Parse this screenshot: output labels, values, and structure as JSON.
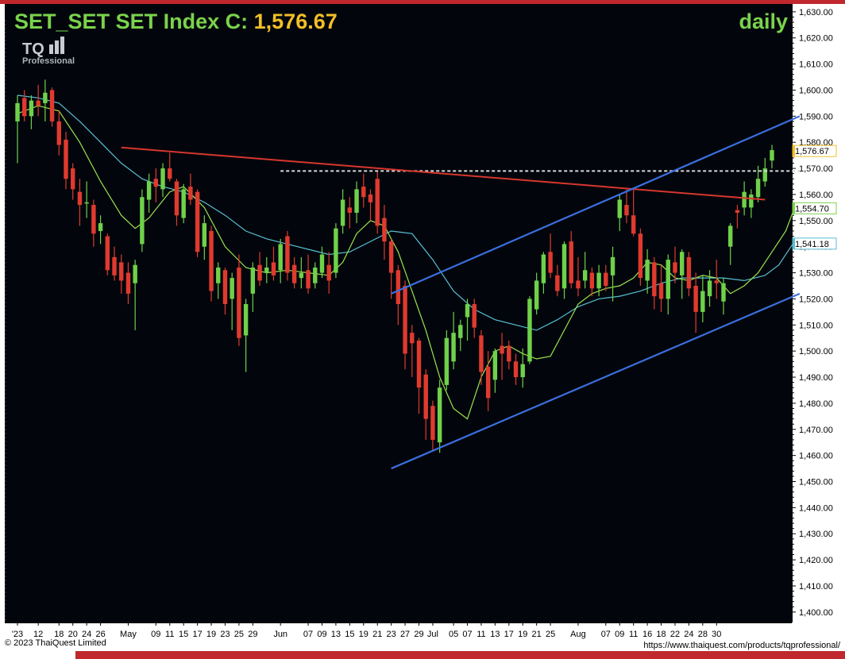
{
  "header": {
    "symbol": "SET",
    "name": "SET Index",
    "close_label": "C:",
    "close_value": "1,576.67",
    "period": "daily",
    "logo_text": "TQ",
    "logo_sub": "Professional"
  },
  "footer": {
    "copyright": "© 2023 ThaiQuest Limited",
    "url": "https://www.thaiquest.com/products/tqprofessional/"
  },
  "colors": {
    "background": "#02060c",
    "up": "#6fd14a",
    "down": "#e03a2f",
    "title": "#7ad34b",
    "close_value": "#f2bf26",
    "ma_fast": "#9be34e",
    "ma_slow": "#57bfd4",
    "trend_channel": "#3b6fe0",
    "resistance_line": "#d8362e",
    "dashed_level": "#d8d8d8"
  },
  "chart_data": {
    "type": "candlestick",
    "title": "SET_SET Index C: 1,576.67",
    "period": "daily",
    "ylim": [
      1396,
      1633
    ],
    "yticks": [
      1400,
      1410,
      1420,
      1430,
      1440,
      1450,
      1460,
      1470,
      1480,
      1490,
      1500,
      1510,
      1520,
      1530,
      1540,
      1550,
      1560,
      1570,
      1580,
      1590,
      1600,
      1610,
      1620,
      1630
    ],
    "ytick_labels": [
      "1,400.00",
      "1,410.00",
      "1,420.00",
      "1,430.00",
      "1,440.00",
      "1,450.00",
      "1,460.00",
      "1,470.00",
      "1,480.00",
      "1,490.00",
      "1,500.00",
      "1,510.00",
      "1,520.00",
      "1,530.00",
      "1,540.00",
      "1,550.00",
      "1,560.00",
      "1,570.00",
      "1,580.00",
      "1,590.00",
      "1,600.00",
      "1,610.00",
      "1,620.00",
      "1,630.00"
    ],
    "xtick_labels": [
      "'23",
      "12",
      "18",
      "20",
      "24",
      "26",
      "May",
      "09",
      "11",
      "15",
      "17",
      "19",
      "23",
      "25",
      "29",
      "Jun",
      "07",
      "09",
      "13",
      "15",
      "19",
      "21",
      "23",
      "27",
      "29",
      "Jul",
      "05",
      "07",
      "11",
      "13",
      "17",
      "19",
      "21",
      "25",
      "Aug",
      "07",
      "09",
      "11",
      "16",
      "18",
      "22",
      "24",
      "28",
      "30"
    ],
    "xtick_bars": [
      0,
      3,
      6,
      8,
      10,
      12,
      16,
      20,
      22,
      24,
      26,
      28,
      30,
      32,
      34,
      38,
      42,
      44,
      46,
      48,
      50,
      52,
      54,
      56,
      58,
      60,
      63,
      65,
      67,
      69,
      71,
      73,
      75,
      77,
      81,
      85,
      87,
      89,
      91,
      93,
      95,
      97,
      99,
      101
    ],
    "price_labels": [
      {
        "value": 1576.67,
        "label": "1,576.67",
        "color": "#f2bf26"
      },
      {
        "value": 1554.7,
        "label": "1,554.70",
        "color": "#7ad34b"
      },
      {
        "value": 1541.18,
        "label": "1,541.18",
        "color": "#57bfd4"
      }
    ],
    "candles": [
      [
        1588,
        1598,
        1572,
        1595
      ],
      [
        1597,
        1600,
        1588,
        1590
      ],
      [
        1590,
        1598,
        1585,
        1596
      ],
      [
        1596,
        1602,
        1590,
        1594
      ],
      [
        1595,
        1604,
        1588,
        1599
      ],
      [
        1600,
        1601,
        1586,
        1588
      ],
      [
        1588,
        1592,
        1575,
        1579
      ],
      [
        1581,
        1584,
        1562,
        1566
      ],
      [
        1570,
        1572,
        1558,
        1562
      ],
      [
        1561,
        1566,
        1548,
        1556
      ],
      [
        1557,
        1565,
        1551,
        1557
      ],
      [
        1556,
        1558,
        1540,
        1545
      ],
      [
        1546,
        1552,
        1541,
        1549
      ],
      [
        1544,
        1545,
        1529,
        1531
      ],
      [
        1536,
        1540,
        1527,
        1529
      ],
      [
        1534,
        1537,
        1522,
        1527
      ],
      [
        1530,
        1534,
        1518,
        1522
      ],
      [
        1526,
        1535,
        1508,
        1533
      ],
      [
        1541,
        1562,
        1538,
        1559
      ],
      [
        1558,
        1568,
        1553,
        1565
      ],
      [
        1566,
        1570,
        1557,
        1563
      ],
      [
        1562,
        1572,
        1559,
        1570
      ],
      [
        1570,
        1576,
        1565,
        1566
      ],
      [
        1565,
        1566,
        1548,
        1552
      ],
      [
        1551,
        1564,
        1549,
        1562
      ],
      [
        1563,
        1568,
        1556,
        1558
      ],
      [
        1561,
        1562,
        1536,
        1538
      ],
      [
        1540,
        1552,
        1535,
        1549
      ],
      [
        1546,
        1548,
        1519,
        1523
      ],
      [
        1526,
        1534,
        1520,
        1532
      ],
      [
        1531,
        1532,
        1514,
        1518
      ],
      [
        1520,
        1530,
        1508,
        1528
      ],
      [
        1532,
        1537,
        1502,
        1505
      ],
      [
        1506,
        1520,
        1492,
        1518
      ],
      [
        1522,
        1534,
        1515,
        1532
      ],
      [
        1533,
        1538,
        1525,
        1527
      ],
      [
        1530,
        1536,
        1526,
        1532
      ],
      [
        1534,
        1540,
        1527,
        1529
      ],
      [
        1531,
        1543,
        1526,
        1541
      ],
      [
        1544,
        1546,
        1527,
        1530
      ],
      [
        1533,
        1536,
        1524,
        1526
      ],
      [
        1528,
        1536,
        1524,
        1530
      ],
      [
        1531,
        1537,
        1522,
        1524
      ],
      [
        1526,
        1534,
        1524,
        1532
      ],
      [
        1530,
        1540,
        1528,
        1537
      ],
      [
        1533,
        1538,
        1522,
        1527
      ],
      [
        1530,
        1549,
        1528,
        1547
      ],
      [
        1548,
        1562,
        1545,
        1558
      ],
      [
        1555,
        1559,
        1547,
        1553
      ],
      [
        1553,
        1565,
        1549,
        1562
      ],
      [
        1563,
        1568,
        1555,
        1559
      ],
      [
        1560,
        1562,
        1550,
        1557
      ],
      [
        1566,
        1569,
        1545,
        1548
      ],
      [
        1551,
        1556,
        1535,
        1542
      ],
      [
        1542,
        1543,
        1520,
        1530
      ],
      [
        1531,
        1533,
        1510,
        1518
      ],
      [
        1525,
        1527,
        1493,
        1499
      ],
      [
        1507,
        1510,
        1490,
        1503
      ],
      [
        1504,
        1505,
        1476,
        1486
      ],
      [
        1491,
        1493,
        1466,
        1474
      ],
      [
        1479,
        1481,
        1462,
        1466
      ],
      [
        1465,
        1489,
        1461,
        1486
      ],
      [
        1487,
        1508,
        1485,
        1505
      ],
      [
        1496,
        1515,
        1493,
        1507
      ],
      [
        1505,
        1512,
        1500,
        1510
      ],
      [
        1513,
        1520,
        1504,
        1518
      ],
      [
        1518,
        1520,
        1505,
        1509
      ],
      [
        1506,
        1508,
        1487,
        1492
      ],
      [
        1494,
        1500,
        1477,
        1482
      ],
      [
        1489,
        1501,
        1484,
        1500
      ],
      [
        1502,
        1507,
        1489,
        1499
      ],
      [
        1502,
        1504,
        1493,
        1496
      ],
      [
        1496,
        1499,
        1487,
        1490
      ],
      [
        1490,
        1501,
        1486,
        1495
      ],
      [
        1496,
        1521,
        1495,
        1520
      ],
      [
        1516,
        1530,
        1514,
        1527
      ],
      [
        1526,
        1538,
        1522,
        1537
      ],
      [
        1538,
        1545,
        1528,
        1530
      ],
      [
        1529,
        1533,
        1521,
        1523
      ],
      [
        1524,
        1542,
        1520,
        1541
      ],
      [
        1542,
        1546,
        1524,
        1526
      ],
      [
        1527,
        1536,
        1521,
        1524
      ],
      [
        1527,
        1538,
        1524,
        1531
      ],
      [
        1530,
        1532,
        1521,
        1524
      ],
      [
        1524,
        1533,
        1521,
        1530
      ],
      [
        1530,
        1533,
        1523,
        1525
      ],
      [
        1529,
        1540,
        1519,
        1536
      ],
      [
        1551,
        1560,
        1546,
        1558
      ],
      [
        1556,
        1562,
        1549,
        1552
      ],
      [
        1552,
        1562,
        1544,
        1545
      ],
      [
        1545,
        1547,
        1525,
        1528
      ],
      [
        1527,
        1539,
        1522,
        1535
      ],
      [
        1534,
        1536,
        1516,
        1521
      ],
      [
        1526,
        1533,
        1515,
        1520
      ],
      [
        1520,
        1537,
        1514,
        1535
      ],
      [
        1534,
        1540,
        1526,
        1530
      ],
      [
        1529,
        1539,
        1520,
        1538
      ],
      [
        1536,
        1538,
        1521,
        1524
      ],
      [
        1525,
        1530,
        1507,
        1515
      ],
      [
        1515,
        1529,
        1511,
        1523
      ],
      [
        1521,
        1531,
        1517,
        1527
      ],
      [
        1527,
        1535,
        1520,
        1526
      ],
      [
        1519,
        1528,
        1514,
        1526
      ],
      [
        1540,
        1549,
        1533,
        1548
      ],
      [
        1554,
        1556,
        1547,
        1553
      ],
      [
        1555,
        1565,
        1552,
        1561
      ],
      [
        1555,
        1562,
        1551,
        1560
      ],
      [
        1559,
        1571,
        1557,
        1566
      ],
      [
        1565,
        1574,
        1563,
        1570
      ],
      [
        1573,
        1579,
        1570,
        1577
      ]
    ],
    "ma_fast": [
      [
        0,
        1591
      ],
      [
        3,
        1594
      ],
      [
        6,
        1592
      ],
      [
        9,
        1580
      ],
      [
        12,
        1565
      ],
      [
        15,
        1552
      ],
      [
        17,
        1547
      ],
      [
        19,
        1551
      ],
      [
        22,
        1561
      ],
      [
        24,
        1563
      ],
      [
        27,
        1555
      ],
      [
        30,
        1540
      ],
      [
        33,
        1532
      ],
      [
        36,
        1530
      ],
      [
        39,
        1531
      ],
      [
        42,
        1530
      ],
      [
        45,
        1529
      ],
      [
        47,
        1534
      ],
      [
        49,
        1545
      ],
      [
        51,
        1550
      ],
      [
        53,
        1548
      ],
      [
        55,
        1538
      ],
      [
        57,
        1523
      ],
      [
        59,
        1508
      ],
      [
        61,
        1490
      ],
      [
        63,
        1478
      ],
      [
        65,
        1474
      ],
      [
        67,
        1490
      ],
      [
        69,
        1500
      ],
      [
        71,
        1502
      ],
      [
        73,
        1499
      ],
      [
        75,
        1497
      ],
      [
        77,
        1498
      ],
      [
        79,
        1508
      ],
      [
        81,
        1518
      ],
      [
        83,
        1522
      ],
      [
        85,
        1524
      ],
      [
        87,
        1525
      ],
      [
        89,
        1528
      ],
      [
        91,
        1534
      ],
      [
        93,
        1533
      ],
      [
        95,
        1528
      ],
      [
        97,
        1527
      ],
      [
        99,
        1529
      ],
      [
        101,
        1528
      ],
      [
        103,
        1522
      ],
      [
        105,
        1525
      ],
      [
        107,
        1530
      ],
      [
        109,
        1538
      ],
      [
        111,
        1546
      ],
      [
        112,
        1553
      ]
    ],
    "ma_slow": [
      [
        0,
        1598
      ],
      [
        3,
        1597
      ],
      [
        6,
        1595
      ],
      [
        9,
        1588
      ],
      [
        12,
        1580
      ],
      [
        15,
        1572
      ],
      [
        18,
        1566
      ],
      [
        21,
        1563
      ],
      [
        24,
        1561
      ],
      [
        27,
        1557
      ],
      [
        30,
        1552
      ],
      [
        33,
        1546
      ],
      [
        36,
        1543
      ],
      [
        39,
        1541
      ],
      [
        42,
        1539
      ],
      [
        45,
        1537
      ],
      [
        48,
        1538
      ],
      [
        51,
        1542
      ],
      [
        54,
        1546
      ],
      [
        57,
        1545
      ],
      [
        60,
        1535
      ],
      [
        63,
        1523
      ],
      [
        66,
        1516
      ],
      [
        69,
        1512
      ],
      [
        72,
        1510
      ],
      [
        75,
        1508
      ],
      [
        78,
        1512
      ],
      [
        81,
        1517
      ],
      [
        84,
        1520
      ],
      [
        87,
        1521
      ],
      [
        90,
        1523
      ],
      [
        93,
        1526
      ],
      [
        96,
        1528
      ],
      [
        99,
        1528
      ],
      [
        102,
        1528
      ],
      [
        105,
        1527
      ],
      [
        108,
        1529
      ],
      [
        110,
        1533
      ],
      [
        112,
        1541
      ]
    ],
    "channel_upper": {
      "from": [
        54,
        1522
      ],
      "to": [
        113,
        1590
      ]
    },
    "channel_lower": {
      "from": [
        54,
        1455
      ],
      "to": [
        113,
        1522
      ]
    },
    "resistance": {
      "from": [
        15,
        1578
      ],
      "to": [
        108,
        1558
      ]
    },
    "dashed_level": {
      "from": [
        38,
        1569
      ],
      "to": [
        113,
        1569
      ]
    }
  }
}
